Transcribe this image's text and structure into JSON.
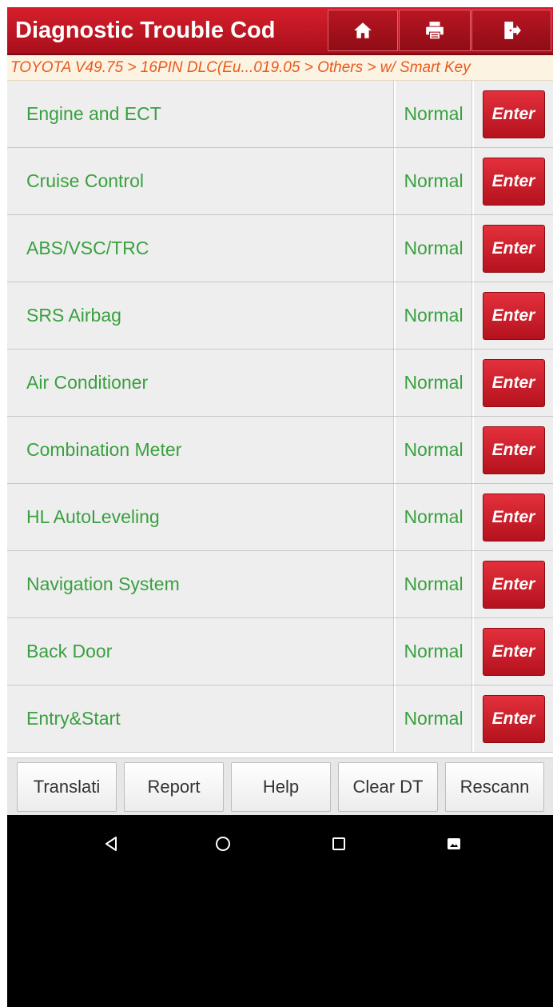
{
  "header": {
    "title": "Diagnostic Trouble Cod",
    "buttons": [
      {
        "name": "home-icon"
      },
      {
        "name": "printer-icon"
      },
      {
        "name": "exit-icon"
      }
    ],
    "colors": {
      "bar": "#c8172a",
      "text": "#ffffff"
    }
  },
  "breadcrumb": "TOYOTA V49.75 > 16PIN DLC(Eu...019.05 > Others > w/ Smart Key",
  "systems": [
    {
      "name": "Engine and ECT",
      "status": "Normal",
      "action": "Enter"
    },
    {
      "name": "Cruise Control",
      "status": "Normal",
      "action": "Enter"
    },
    {
      "name": "ABS/VSC/TRC",
      "status": "Normal",
      "action": "Enter"
    },
    {
      "name": "SRS Airbag",
      "status": "Normal",
      "action": "Enter"
    },
    {
      "name": "Air Conditioner",
      "status": "Normal",
      "action": "Enter"
    },
    {
      "name": "Combination Meter",
      "status": "Normal",
      "action": "Enter"
    },
    {
      "name": "HL AutoLeveling",
      "status": "Normal",
      "action": "Enter"
    },
    {
      "name": "Navigation System",
      "status": "Normal",
      "action": "Enter"
    },
    {
      "name": "Back Door",
      "status": "Normal",
      "action": "Enter"
    },
    {
      "name": "Entry&Start",
      "status": "Normal",
      "action": "Enter"
    }
  ],
  "toolbar": {
    "translate": "Translati",
    "report": "Report",
    "help": "Help",
    "clear_dtc": "Clear DT",
    "rescan": "Rescann"
  },
  "navbar": {
    "icons": [
      "back-triangle-icon",
      "home-circle-icon",
      "recents-square-icon",
      "screenshot-icon"
    ]
  },
  "colors": {
    "status_text": "#3aa040",
    "enter_button": "#c41826",
    "breadcrumb_text": "#e75a1c"
  }
}
